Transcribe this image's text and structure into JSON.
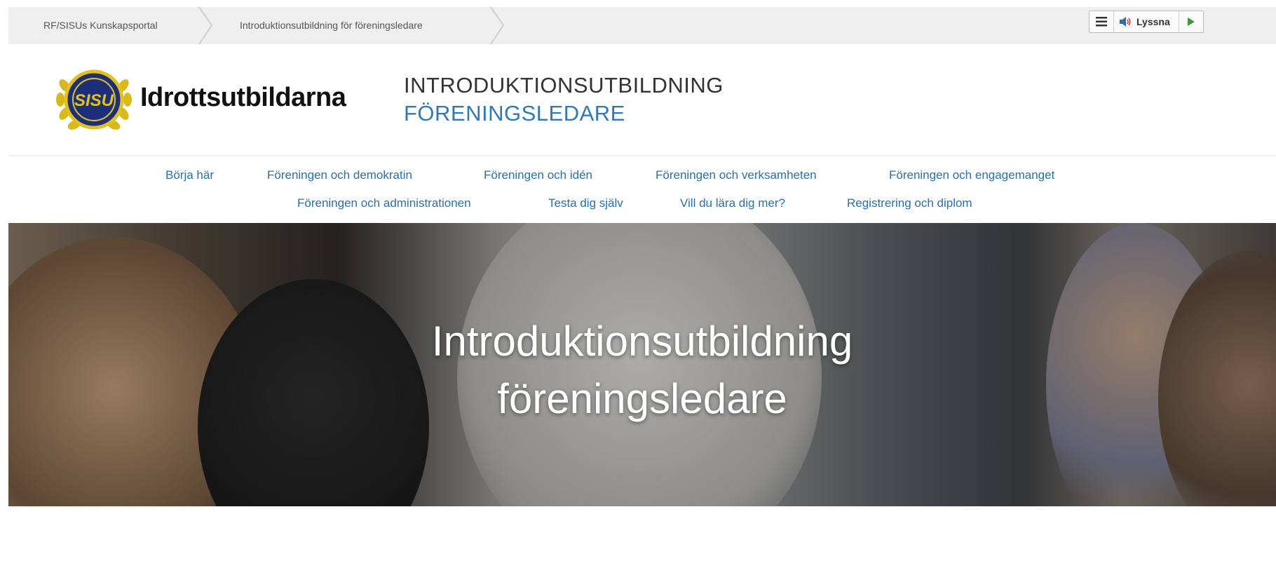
{
  "breadcrumb": {
    "items": [
      "RF/SISUs Kunskapsportal",
      "Introduktionsutbildning för föreningsledare"
    ]
  },
  "readspeaker": {
    "listen_label": "Lyssna",
    "icons": [
      "menu-icon",
      "speaker-icon",
      "play-icon"
    ]
  },
  "header": {
    "logo_text": "SISU",
    "brand": "Idrottsutbildarna",
    "course_line1": "INTRODUKTIONSUTBILDNING",
    "course_line2": "FÖRENINGSLEDARE"
  },
  "nav": {
    "row1": [
      "Börja här",
      "Föreningen och demokratin",
      "Föreningen och idén",
      "Föreningen och verksamheten",
      "Föreningen och engagemanget"
    ],
    "row2": [
      "Föreningen och administrationen",
      "Testa dig själv",
      "Vill du lära dig mer?",
      "Registrering och diplom"
    ]
  },
  "hero": {
    "title_line1": "Introduktionsutbildning",
    "title_line2": "föreningsledare"
  },
  "colors": {
    "nav_link": "#2a6fa8",
    "course_accent": "#2f79b8",
    "logo_blue": "#1d2f7a",
    "logo_gold": "#e2c21a",
    "topbar_bg": "#efefef"
  }
}
